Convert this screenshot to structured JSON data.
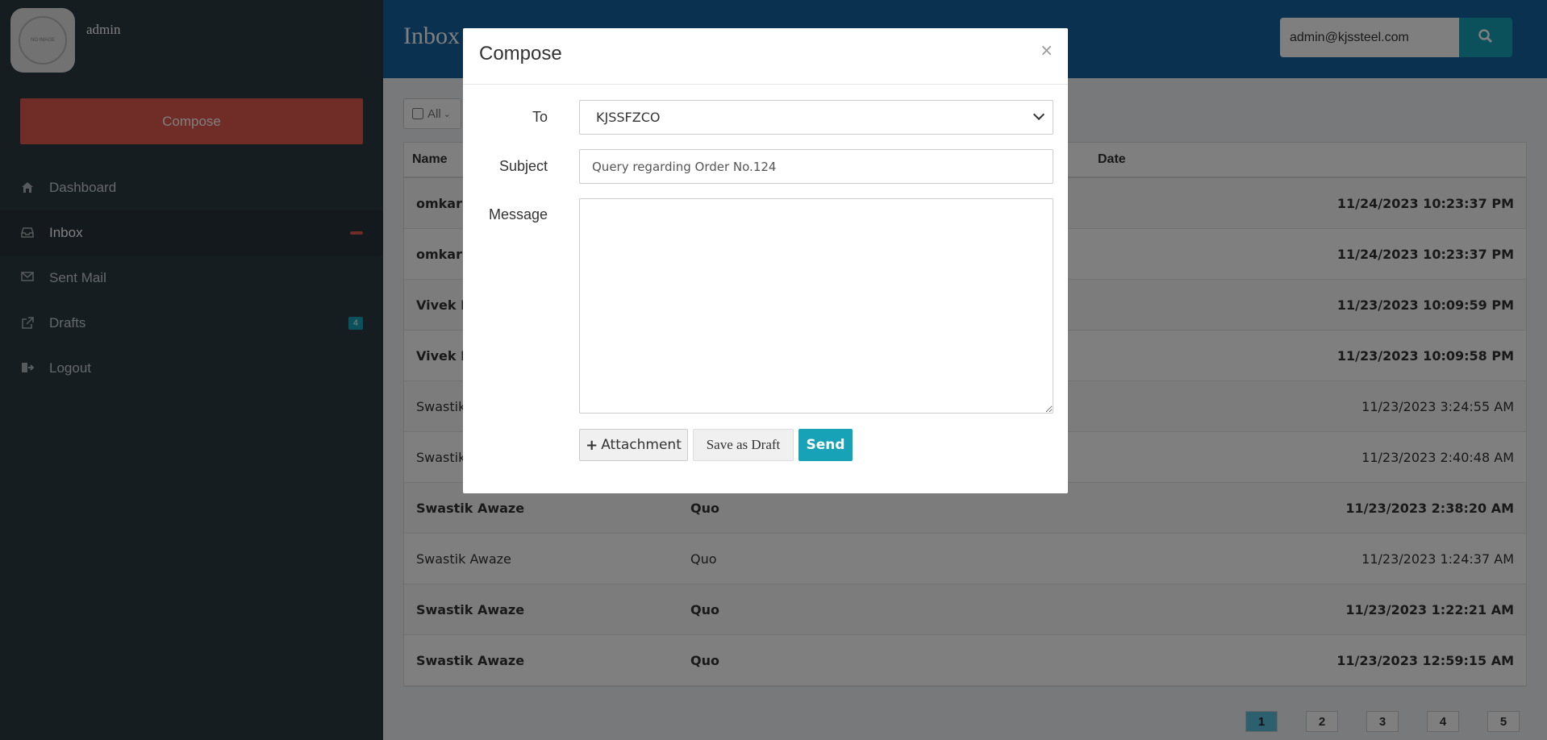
{
  "user": {
    "name": "admin",
    "avatar_text": "NO IMAGE"
  },
  "sidebar": {
    "compose_label": "Compose",
    "items": [
      {
        "label": "Dashboard",
        "icon": "home-icon"
      },
      {
        "label": "Inbox",
        "icon": "inbox-icon",
        "badge": ""
      },
      {
        "label": "Sent Mail",
        "icon": "envelope-icon"
      },
      {
        "label": "Drafts",
        "icon": "external-link-icon",
        "badge": "4"
      },
      {
        "label": "Logout",
        "icon": "sign-out-icon"
      }
    ]
  },
  "header": {
    "title": "Inbox",
    "search_value": "admin@kjssteel.com"
  },
  "toolbar": {
    "select_all_label": "All"
  },
  "table": {
    "columns": [
      "Name",
      "Date"
    ],
    "rows": [
      {
        "name": "omkar",
        "subject": "",
        "date": "11/24/2023 10:23:37 PM",
        "unread": true
      },
      {
        "name": "omkar",
        "subject": "",
        "date": "11/24/2023 10:23:37 PM",
        "unread": true
      },
      {
        "name": "Vivek M",
        "subject": "",
        "date": "11/23/2023 10:09:59 PM",
        "unread": true
      },
      {
        "name": "Vivek M",
        "subject": "",
        "date": "11/23/2023 10:09:58 PM",
        "unread": true
      },
      {
        "name": "Swastik",
        "subject": "",
        "date": "11/23/2023 3:24:55 AM",
        "unread": false
      },
      {
        "name": "Swastik",
        "subject": "",
        "date": "11/23/2023 2:40:48 AM",
        "unread": false
      },
      {
        "name": "Swastik Awaze",
        "subject": "Quo",
        "date": "11/23/2023 2:38:20 AM",
        "unread": true
      },
      {
        "name": "Swastik Awaze",
        "subject": "Quo",
        "date": "11/23/2023 1:24:37 AM",
        "unread": false
      },
      {
        "name": "Swastik Awaze",
        "subject": "Quo",
        "date": "11/23/2023 1:22:21 AM",
        "unread": true
      },
      {
        "name": "Swastik Awaze",
        "subject": "Quo",
        "date": "11/23/2023 12:59:15 AM",
        "unread": true
      }
    ]
  },
  "pagination": {
    "pages": [
      "1",
      "2",
      "3",
      "4",
      "5"
    ],
    "current": "1"
  },
  "modal": {
    "title": "Compose",
    "close": "×",
    "to_label": "To",
    "to_value": "KJSSFZCO",
    "subject_label": "Subject",
    "subject_value": "Query regarding Order No.124",
    "message_label": "Message",
    "message_value": "",
    "attachment_label": "Attachment",
    "draft_label": "Save as Draft",
    "send_label": "Send"
  }
}
